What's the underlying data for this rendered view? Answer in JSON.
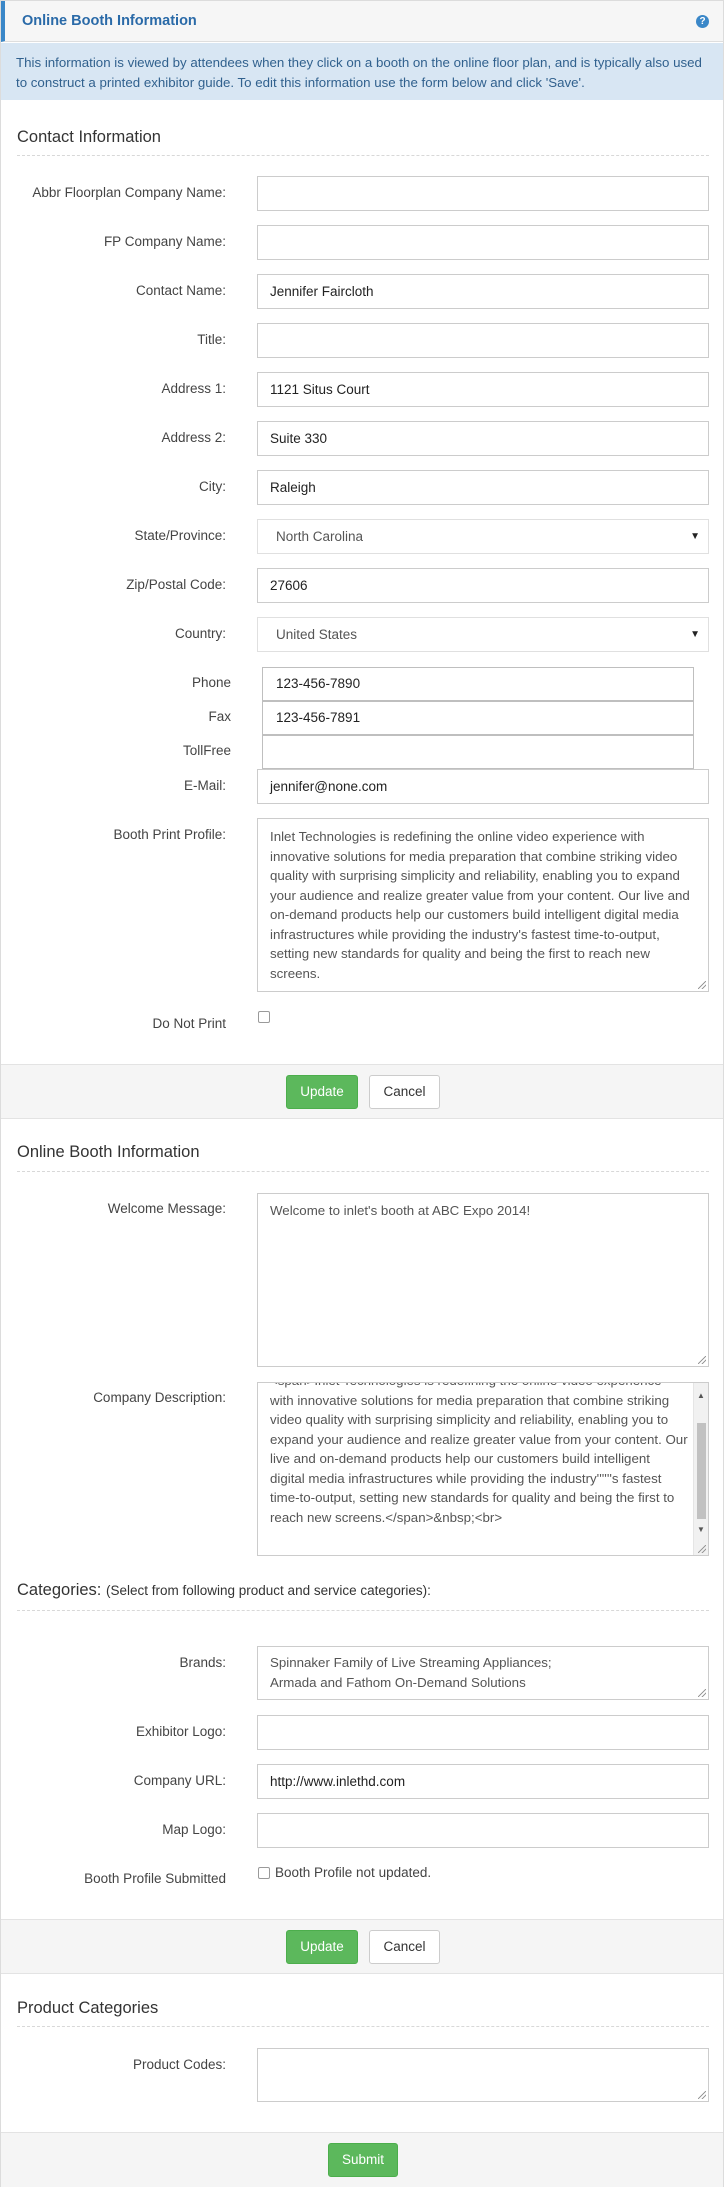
{
  "header": {
    "title": "Online Booth Information",
    "help_icon": "?"
  },
  "info_text": "This information is viewed by attendees when they click on a booth on the online floor plan, and is typically also used to construct a printed exhibitor guide. To edit this information use the form below and click 'Save'.",
  "contact": {
    "section_title": "Contact Information",
    "fields": {
      "abbr_company": {
        "label": "Abbr Floorplan Company Name:",
        "value": ""
      },
      "fp_company": {
        "label": "FP Company Name:",
        "value": ""
      },
      "contact_name": {
        "label": "Contact Name:",
        "value": "Jennifer Faircloth"
      },
      "title": {
        "label": "Title:",
        "value": ""
      },
      "address1": {
        "label": "Address 1:",
        "value": "1121 Situs Court"
      },
      "address2": {
        "label": "Address 2:",
        "value": "Suite 330"
      },
      "city": {
        "label": "City:",
        "value": "Raleigh"
      },
      "state": {
        "label": "State/Province:",
        "value": "North Carolina"
      },
      "zip": {
        "label": "Zip/Postal Code:",
        "value": "27606"
      },
      "country": {
        "label": "Country:",
        "value": "United States"
      },
      "phone": {
        "label": "Phone",
        "value": "123-456-7890"
      },
      "fax": {
        "label": "Fax",
        "value": "123-456-7891"
      },
      "tollfree": {
        "label": "TollFree",
        "value": ""
      },
      "email": {
        "label": "E-Mail:",
        "value": "jennifer@none.com"
      },
      "booth_profile": {
        "label": "Booth Print Profile:",
        "value": "Inlet Technologies is redefining the online video experience with innovative solutions for media preparation that combine striking video quality with surprising simplicity and reliability, enabling you to expand your audience and realize greater value from your content. Our live and on-demand products help our customers build intelligent digital media infrastructures while providing the industry's fastest time-to-output, setting new standards for quality and being the first to reach new screens."
      },
      "do_not_print": {
        "label": "Do Not Print",
        "checked": false
      }
    }
  },
  "actions": {
    "update_label": "Update",
    "cancel_label": "Cancel",
    "submit_label": "Submit"
  },
  "online": {
    "section_title": "Online Booth Information",
    "welcome": {
      "label": "Welcome Message:",
      "value": "Welcome to inlet's booth at ABC Expo 2014!"
    },
    "description": {
      "label": "Company Description:",
      "value": "<span>Inlet Technologies is redefining the online video experience with innovative solutions for media preparation that combine striking video quality with surprising simplicity and reliability, enabling you to expand your audience and realize greater value from your content. Our live and on-demand products help our customers build intelligent digital media infrastructures while providing the industry''''''s fastest time-to-output, setting new standards for quality and being the first to reach new screens.</span>&nbsp;<br>"
    }
  },
  "categories": {
    "title": "Categories:",
    "subtitle": "(Select from following product and service categories):",
    "brands": {
      "label": "Brands:",
      "line1": "Spinnaker Family of Live Streaming Appliances;",
      "line2": "Armada and Fathom On-Demand Solutions"
    },
    "exhibitor_logo": {
      "label": "Exhibitor Logo:",
      "value": ""
    },
    "company_url": {
      "label": "Company URL:",
      "value": "http://www.inlethd.com"
    },
    "map_logo": {
      "label": "Map Logo:",
      "value": ""
    },
    "profile_submitted": {
      "label": "Booth Profile Submitted",
      "checkbox_text": "Booth Profile not updated.",
      "checked": false
    }
  },
  "product": {
    "section_title": "Product Categories",
    "codes": {
      "label": "Product Codes:",
      "value": ""
    }
  }
}
